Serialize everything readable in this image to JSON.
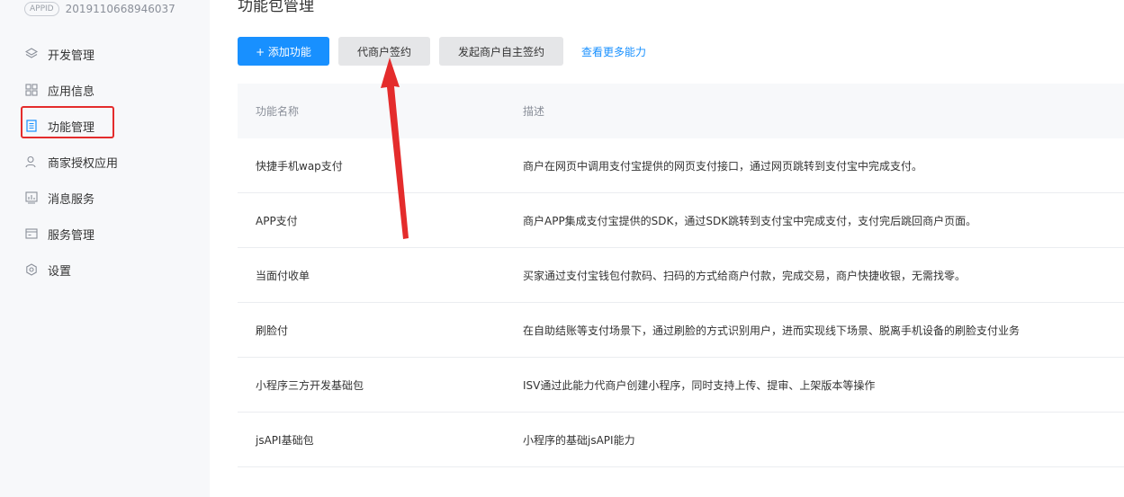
{
  "sidebar": {
    "appid_badge": "APPID",
    "appid_value": "2019110668946037",
    "items": [
      {
        "label": "开发管理"
      },
      {
        "label": "应用信息"
      },
      {
        "label": "功能管理"
      },
      {
        "label": "商家授权应用"
      },
      {
        "label": "消息服务"
      },
      {
        "label": "服务管理"
      },
      {
        "label": "设置"
      }
    ]
  },
  "main": {
    "title": "功能包管理",
    "toolbar": {
      "add_label": "+ 添加功能",
      "agent_sign_label": "代商户签约",
      "merchant_self_sign_label": "发起商户自主签约",
      "more_link": "查看更多能力"
    },
    "table": {
      "headers": {
        "name": "功能名称",
        "desc": "描述"
      },
      "rows": [
        {
          "name": "快捷手机wap支付",
          "desc": "商户在网页中调用支付宝提供的网页支付接口，通过网页跳转到支付宝中完成支付。"
        },
        {
          "name": "APP支付",
          "desc": "商户APP集成支付宝提供的SDK，通过SDK跳转到支付宝中完成支付，支付完后跳回商户页面。"
        },
        {
          "name": "当面付收单",
          "desc": "买家通过支付宝钱包付款码、扫码的方式给商户付款，完成交易，商户快捷收银，无需找零。"
        },
        {
          "name": "刷脸付",
          "desc": "在自助结账等支付场景下，通过刷脸的方式识别用户，进而实现线下场景、脱离手机设备的刷脸支付业务"
        },
        {
          "name": "小程序三方开发基础包",
          "desc": "ISV通过此能力代商户创建小程序，同时支持上传、提审、上架版本等操作"
        },
        {
          "name": "jsAPI基础包",
          "desc": "小程序的基础jsAPI能力"
        }
      ]
    }
  },
  "colors": {
    "primary": "#1890ff",
    "annotation_red": "#e42c2c"
  }
}
